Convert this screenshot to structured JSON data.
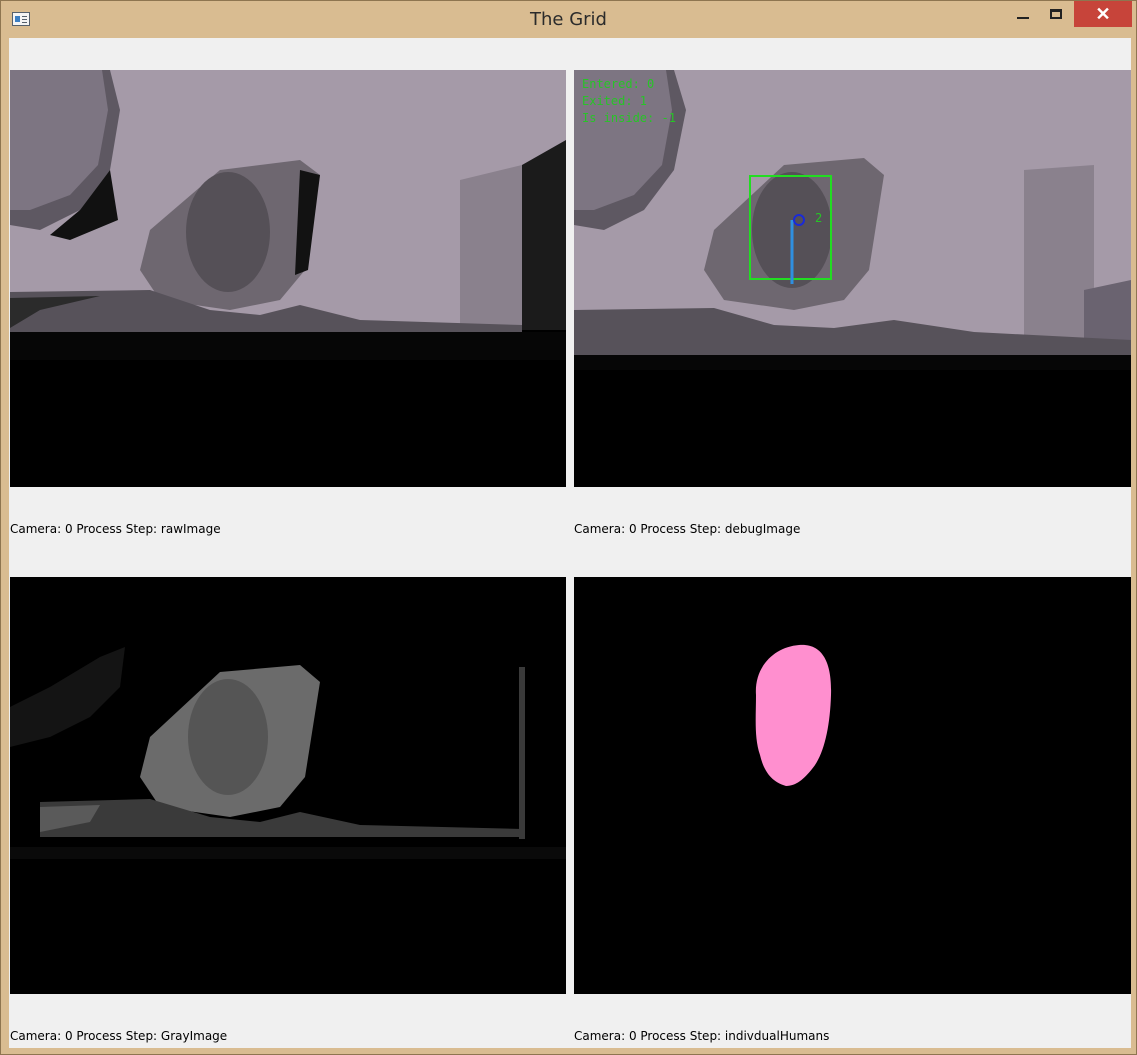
{
  "window": {
    "title": "The Grid",
    "controls": {
      "minimize": "minimize",
      "maximize": "maximize",
      "close": "✕"
    }
  },
  "panes": [
    {
      "camera_label": "Camera: 0 Process Step: rawImage"
    },
    {
      "camera_label": "Camera: 0 Process Step: debugImage",
      "overlay": {
        "entered": "Entered: 0",
        "exited": "Exited: 1",
        "inside": "Is inside: -1",
        "track_id": "2"
      }
    },
    {
      "camera_label": "Camera: 0 Process Step: GrayImage"
    },
    {
      "camera_label": "Camera: 0 Process Step: indivdualHumans"
    }
  ],
  "colors": {
    "track_box": "#22dd22",
    "track_point": "#1a2ad8",
    "track_line": "#2f8fe0",
    "human_mask": "#ff8fcf",
    "depth_background": "#a59aa8"
  }
}
